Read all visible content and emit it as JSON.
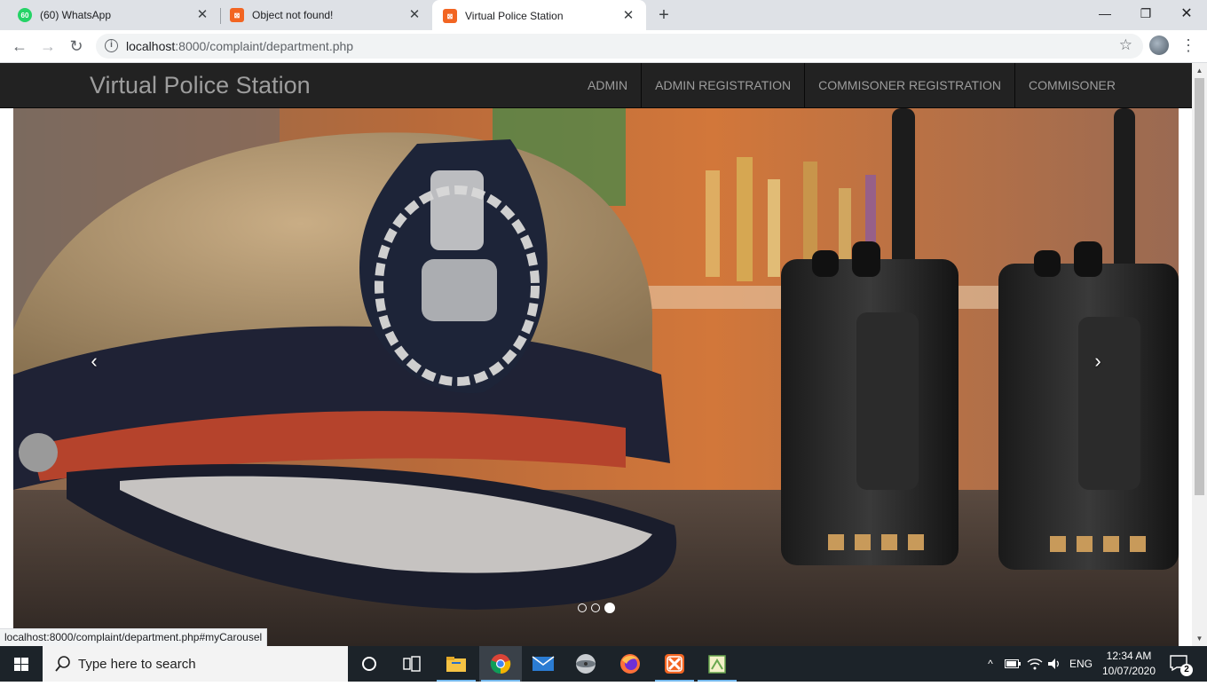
{
  "browser": {
    "tabs": [
      {
        "title": "(60) WhatsApp",
        "favicon_badge": "60",
        "favicon_color": "#25d366",
        "active": false
      },
      {
        "title": "Object not found!",
        "favicon_color": "#f26522",
        "active": false
      },
      {
        "title": "Virtual Police Station",
        "favicon_color": "#f26522",
        "active": true
      }
    ],
    "url_host": "localhost",
    "url_rest": ":8000/complaint/department.php",
    "status_url": "localhost:8000/complaint/department.php#myCarousel"
  },
  "site": {
    "brand": "Virtual Police Station",
    "nav": [
      {
        "label": "ADMIN"
      },
      {
        "label": "ADMIN REGISTRATION"
      },
      {
        "label": "COMMISONER REGISTRATION"
      },
      {
        "label": "COMMISONER"
      }
    ]
  },
  "carousel": {
    "prev_glyph": "‹",
    "next_glyph": "›",
    "slide_count": 3,
    "active_index": 2,
    "slide_description": "Police officer peaked cap with IPS badge beside two walkie-talkie radios"
  },
  "taskbar": {
    "search_placeholder": "Type here to search",
    "apps": [
      "task-view",
      "file-explorer",
      "chrome",
      "mail",
      "disk",
      "firefox",
      "xampp",
      "notepad"
    ],
    "language": "ENG",
    "time": "12:34 AM",
    "date": "10/07/2020",
    "notifications": "2"
  },
  "colors": {
    "navbar_bg": "#222222",
    "navbar_text": "#9d9d9d",
    "taskbar_bg": "#1c2329",
    "tabstrip_bg": "#dee1e6"
  }
}
